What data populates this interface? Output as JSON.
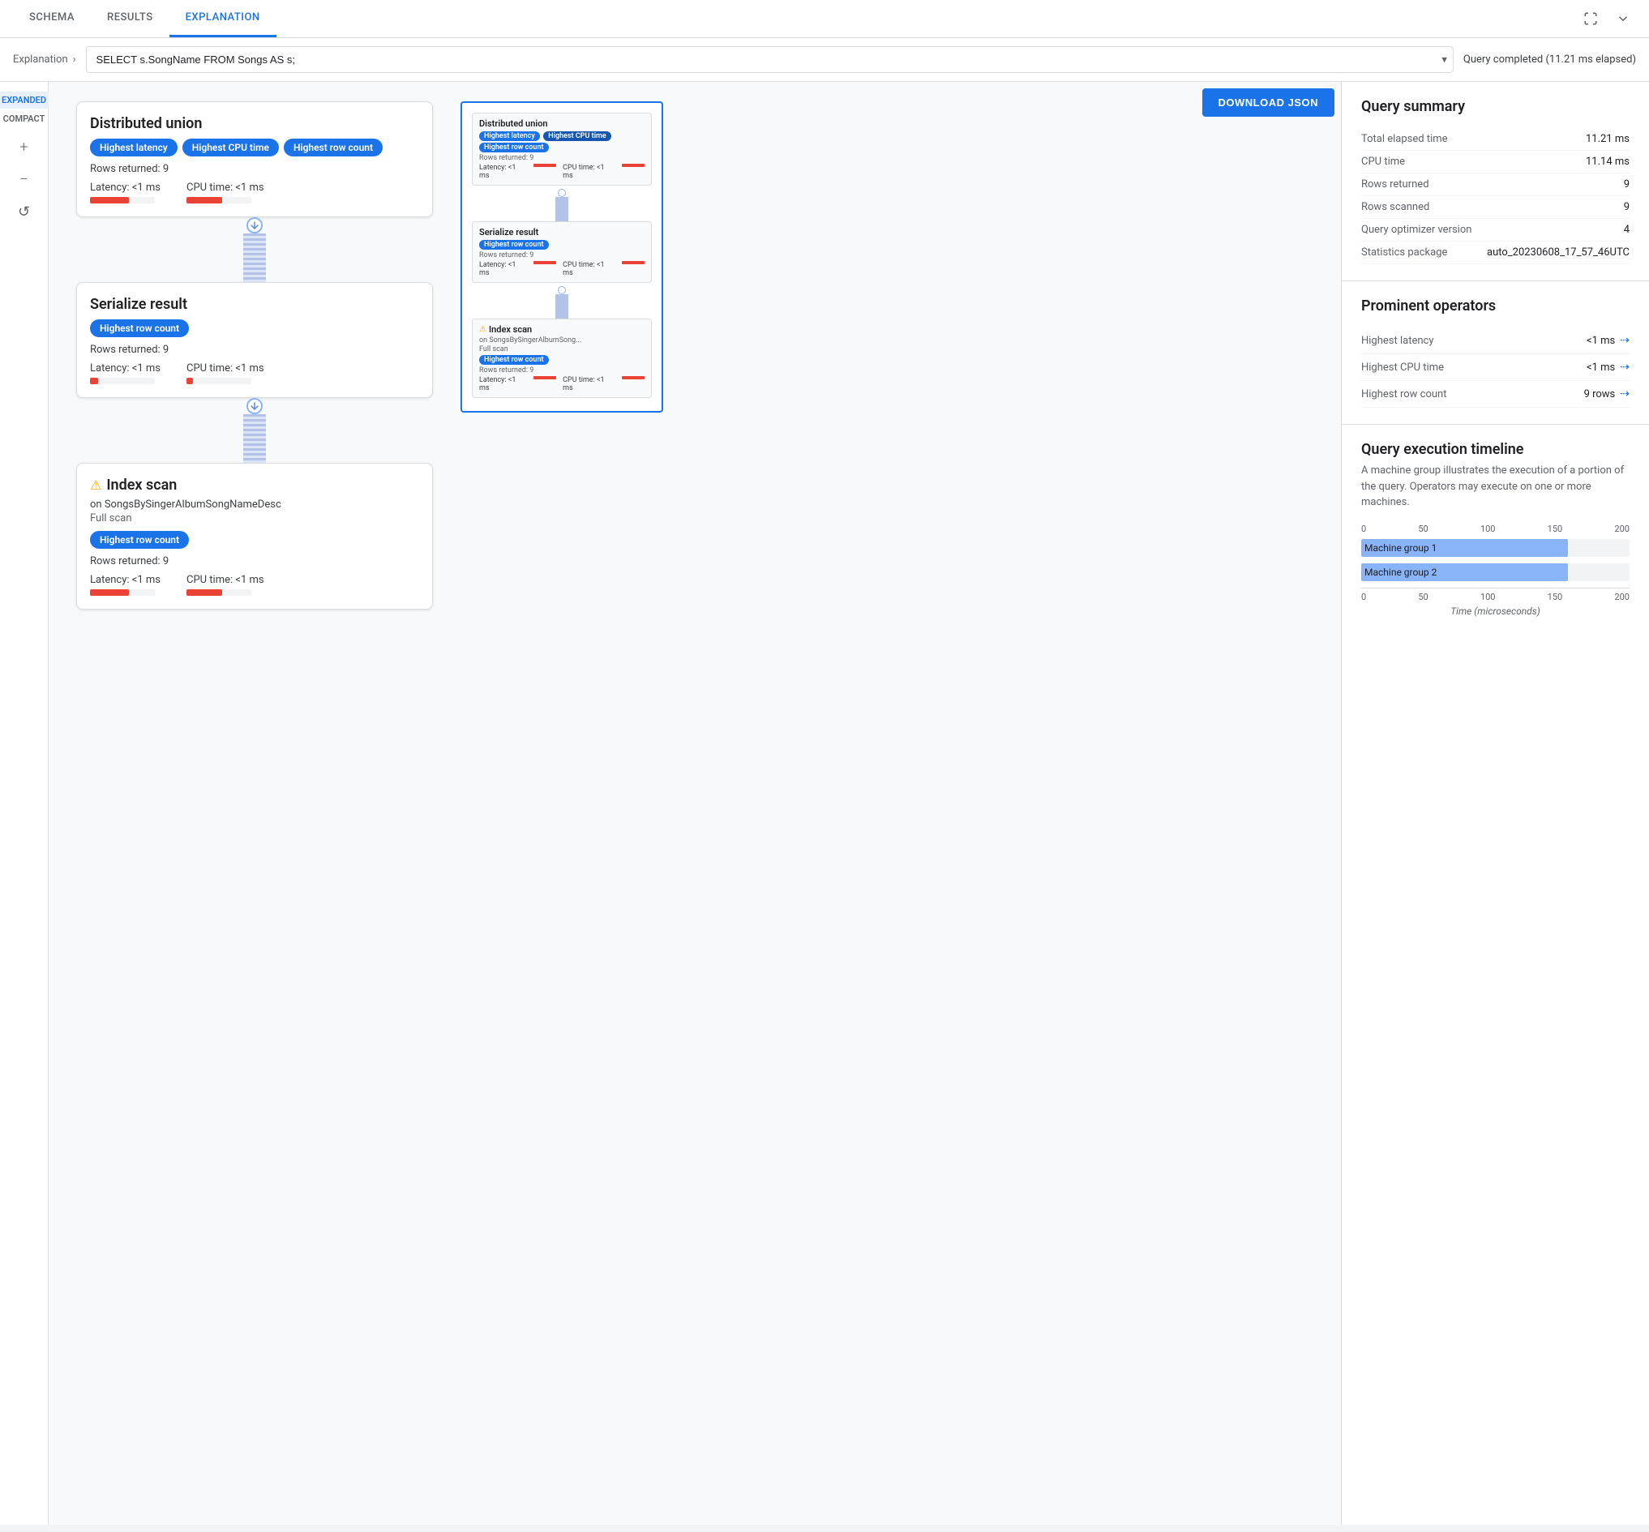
{
  "tabs": {
    "schema": "SCHEMA",
    "results": "RESULTS",
    "explanation": "EXPLANATION",
    "active": "explanation"
  },
  "query_bar": {
    "breadcrumb": "Explanation",
    "query_text": "SELECT s.SongName FROM Songs AS s;",
    "status": "Query completed (11.21 ms elapsed)"
  },
  "toolbar": {
    "download_btn": "DOWNLOAD JSON",
    "expanded_label": "EXPANDED",
    "compact_label": "COMPACT",
    "zoom_in": "+",
    "zoom_out": "−",
    "reset": "↺"
  },
  "nodes": [
    {
      "id": "distributed_union",
      "title": "Distributed union",
      "badges": [
        "Highest latency",
        "Highest CPU time",
        "Highest row count"
      ],
      "badge_colors": [
        "blue",
        "blue",
        "blue"
      ],
      "rows_returned": "Rows returned: 9",
      "latency_label": "Latency: <1 ms",
      "cpu_label": "CPU time: <1 ms",
      "latency_bar_width": "60%",
      "cpu_bar_width": "55%",
      "has_warning": false
    },
    {
      "id": "serialize_result",
      "title": "Serialize result",
      "badges": [
        "Highest row count"
      ],
      "badge_colors": [
        "blue"
      ],
      "rows_returned": "Rows returned: 9",
      "latency_label": "Latency: <1 ms",
      "cpu_label": "CPU time: <1 ms",
      "latency_bar_width": "12%",
      "cpu_bar_width": "10%",
      "has_warning": false
    },
    {
      "id": "index_scan",
      "title": "Index scan",
      "subtitle": "on SongsBySingerAlbumSongNameDesc",
      "subtitle2": "Full scan",
      "badges": [
        "Highest row count"
      ],
      "badge_colors": [
        "blue"
      ],
      "rows_returned": "Rows returned: 9",
      "latency_label": "Latency: <1 ms",
      "cpu_label": "CPU time: <1 ms",
      "latency_bar_width": "60%",
      "cpu_bar_width": "55%",
      "has_warning": true
    }
  ],
  "query_summary": {
    "title": "Query summary",
    "rows": [
      {
        "label": "Total elapsed time",
        "value": "11.21 ms"
      },
      {
        "label": "CPU time",
        "value": "11.14 ms"
      },
      {
        "label": "Rows returned",
        "value": "9"
      },
      {
        "label": "Rows scanned",
        "value": "9"
      },
      {
        "label": "Query optimizer version",
        "value": "4"
      },
      {
        "label": "Statistics package",
        "value": "auto_20230608_17_57_46UTC"
      }
    ]
  },
  "prominent_operators": {
    "title": "Prominent operators",
    "rows": [
      {
        "label": "Highest latency",
        "value": "<1 ms"
      },
      {
        "label": "Highest CPU time",
        "value": "<1 ms"
      },
      {
        "label": "Highest row count",
        "value": "9 rows"
      }
    ]
  },
  "execution_timeline": {
    "title": "Query execution timeline",
    "description": "A machine group illustrates the execution of a portion of the query.\nOperators may execute on one or more machines.",
    "x_axis_labels": [
      "0",
      "50",
      "100",
      "150",
      "200"
    ],
    "bars": [
      {
        "label": "Machine group 1",
        "width_pct": 77
      },
      {
        "label": "Machine group 2",
        "width_pct": 77
      }
    ],
    "x_axis_title": "Time (microseconds)"
  },
  "minimap": {
    "nodes": [
      {
        "title": "Distributed union",
        "badges": [
          "Highest latency",
          "Highest CPU time"
        ],
        "badge2": [
          "Highest row count"
        ],
        "rows": "Rows returned: 9",
        "latency": "Latency: <1 ms",
        "cpu": "CPU time: <1 ms"
      },
      {
        "title": "Serialize result",
        "badges": [
          "Highest row count"
        ],
        "rows": "Rows returned: 9",
        "latency": "Latency: <1 ms",
        "cpu": "CPU time: <1 ms"
      },
      {
        "title": "Index scan",
        "subtitle": "on SongsBySingerAlbumSong...",
        "subtitle2": "Full scan",
        "badges": [
          "Highest row count"
        ],
        "rows": "Rows returned: 9",
        "latency": "Latency: <1 ms",
        "cpu": "CPU time: <1 ms",
        "has_warning": true
      }
    ]
  }
}
